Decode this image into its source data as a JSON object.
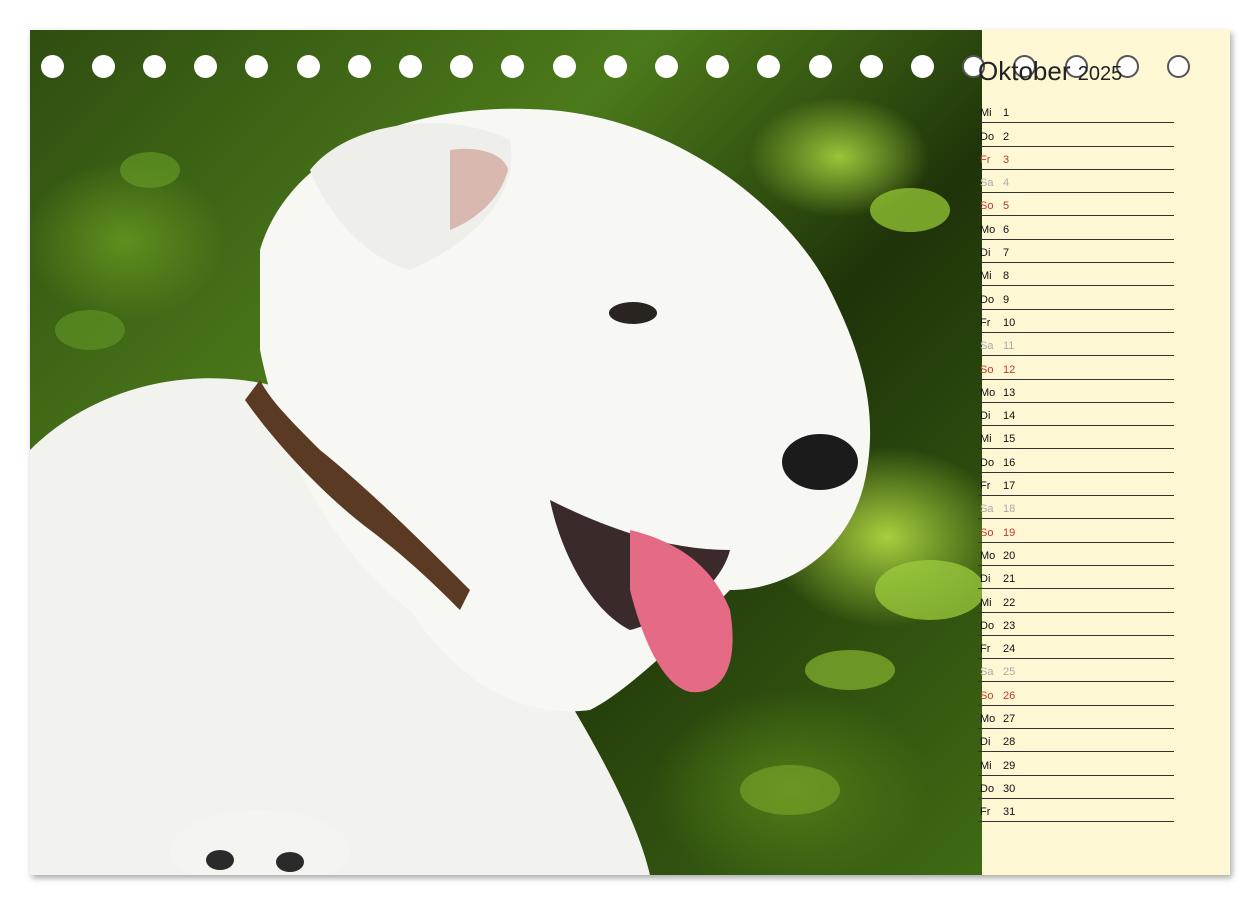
{
  "calendar": {
    "month": "Oktober",
    "year": "2025",
    "colors": {
      "panel_bg": "#fdf7d4",
      "weekday": "#111111",
      "saturday": "#aaaaaa",
      "sunday_holiday": "#c0392b"
    },
    "days": [
      {
        "dn": "Mi",
        "dd": "1",
        "type": "weekday"
      },
      {
        "dn": "Do",
        "dd": "2",
        "type": "weekday"
      },
      {
        "dn": "Fr",
        "dd": "3",
        "type": "hol"
      },
      {
        "dn": "Sa",
        "dd": "4",
        "type": "sat"
      },
      {
        "dn": "So",
        "dd": "5",
        "type": "sun"
      },
      {
        "dn": "Mo",
        "dd": "6",
        "type": "weekday"
      },
      {
        "dn": "Di",
        "dd": "7",
        "type": "weekday"
      },
      {
        "dn": "Mi",
        "dd": "8",
        "type": "weekday"
      },
      {
        "dn": "Do",
        "dd": "9",
        "type": "weekday"
      },
      {
        "dn": "Fr",
        "dd": "10",
        "type": "weekday"
      },
      {
        "dn": "Sa",
        "dd": "11",
        "type": "sat"
      },
      {
        "dn": "So",
        "dd": "12",
        "type": "sun"
      },
      {
        "dn": "Mo",
        "dd": "13",
        "type": "weekday"
      },
      {
        "dn": "Di",
        "dd": "14",
        "type": "weekday"
      },
      {
        "dn": "Mi",
        "dd": "15",
        "type": "weekday"
      },
      {
        "dn": "Do",
        "dd": "16",
        "type": "weekday"
      },
      {
        "dn": "Fr",
        "dd": "17",
        "type": "weekday"
      },
      {
        "dn": "Sa",
        "dd": "18",
        "type": "sat"
      },
      {
        "dn": "So",
        "dd": "19",
        "type": "sun"
      },
      {
        "dn": "Mo",
        "dd": "20",
        "type": "weekday"
      },
      {
        "dn": "Di",
        "dd": "21",
        "type": "weekday"
      },
      {
        "dn": "Mi",
        "dd": "22",
        "type": "weekday"
      },
      {
        "dn": "Do",
        "dd": "23",
        "type": "weekday"
      },
      {
        "dn": "Fr",
        "dd": "24",
        "type": "weekday"
      },
      {
        "dn": "Sa",
        "dd": "25",
        "type": "sat"
      },
      {
        "dn": "So",
        "dd": "26",
        "type": "sun"
      },
      {
        "dn": "Mo",
        "dd": "27",
        "type": "weekday"
      },
      {
        "dn": "Di",
        "dd": "28",
        "type": "weekday"
      },
      {
        "dn": "Mi",
        "dd": "29",
        "type": "weekday"
      },
      {
        "dn": "Do",
        "dd": "30",
        "type": "weekday"
      },
      {
        "dn": "Fr",
        "dd": "31",
        "type": "weekday"
      }
    ]
  },
  "photo": {
    "subject": "white-terrier-puppy-photo"
  }
}
